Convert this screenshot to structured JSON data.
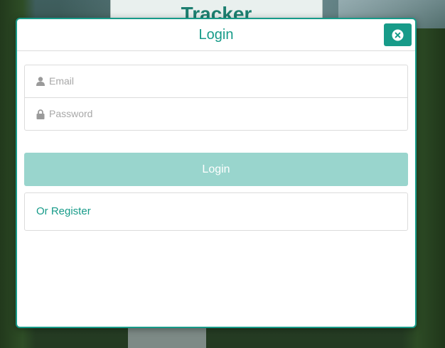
{
  "background": {
    "brand_title": "Tracker"
  },
  "modal": {
    "title": "Login",
    "close_icon": "close-circle-icon",
    "email": {
      "icon": "user-icon",
      "placeholder": "Email",
      "value": ""
    },
    "password": {
      "icon": "lock-icon",
      "placeholder": "Password",
      "value": ""
    },
    "login_label": "Login",
    "register_label": "Or Register"
  },
  "colors": {
    "accent": "#179b89",
    "login_button_disabled": "#99d5cd",
    "border": "#dcdcdc"
  }
}
